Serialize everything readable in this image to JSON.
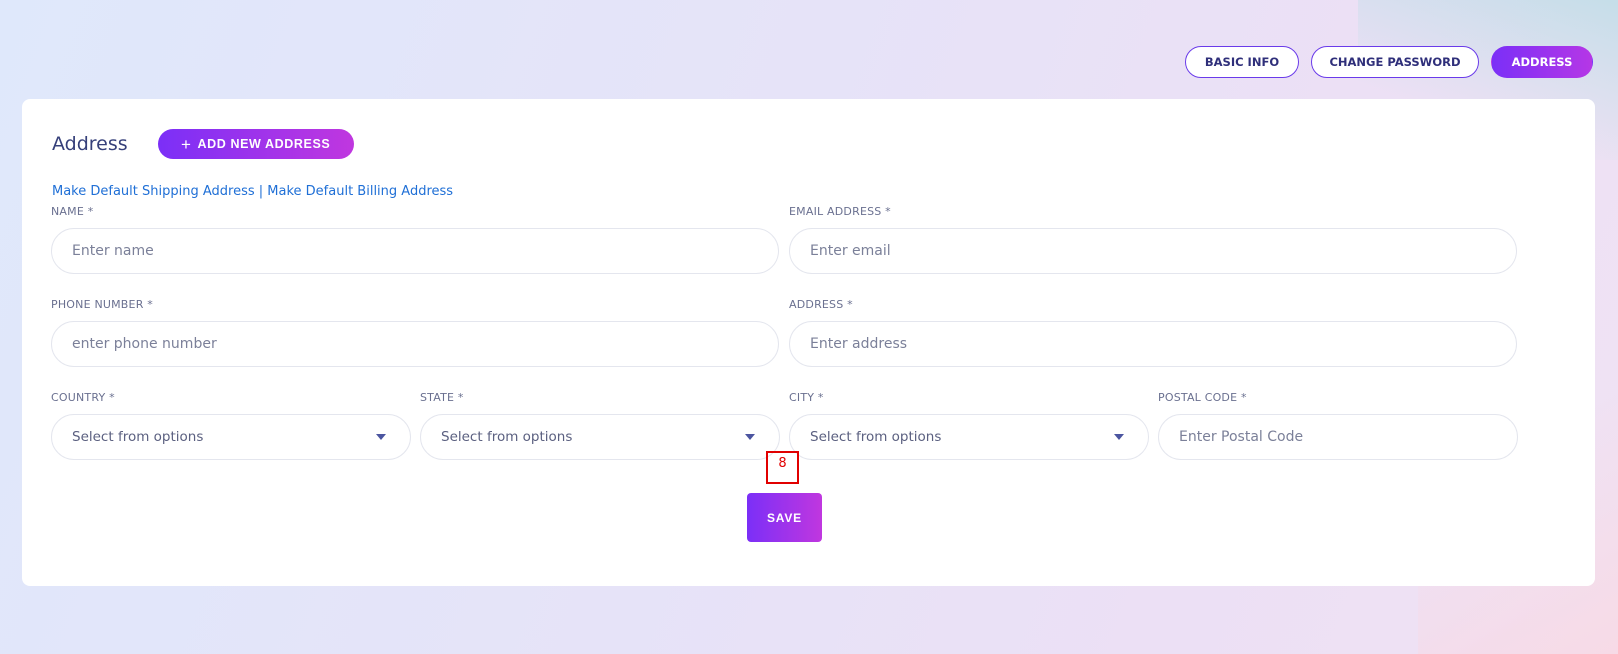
{
  "tabs": {
    "basic_info": "BASIC INFO",
    "change_password": "CHANGE PASSWORD",
    "address": "ADDRESS"
  },
  "card": {
    "title": "Address",
    "add_button": "ADD NEW ADDRESS",
    "link_shipping": "Make Default Shipping Address",
    "link_separator": "|",
    "link_billing": "Make Default Billing Address"
  },
  "form": {
    "name": {
      "label": "NAME *",
      "placeholder": "Enter name"
    },
    "email": {
      "label": "EMAIL ADDRESS *",
      "placeholder": "Enter email"
    },
    "phone": {
      "label": "PHONE NUMBER *",
      "placeholder": "enter phone number"
    },
    "address": {
      "label": "ADDRESS *",
      "placeholder": "Enter address"
    },
    "country": {
      "label": "COUNTRY *",
      "value": "Select from options"
    },
    "state": {
      "label": "STATE *",
      "value": "Select from options"
    },
    "city": {
      "label": "CITY *",
      "value": "Select from options"
    },
    "postal": {
      "label": "POSTAL CODE *",
      "placeholder": "Enter Postal Code"
    },
    "save_label": "SAVE"
  },
  "annotation": {
    "marker_label": "8"
  },
  "colors": {
    "accent_start": "#7b2ff7",
    "accent_end": "#c037df",
    "link": "#1f6fd6",
    "marker": "#e10000"
  },
  "icons": [
    "plus-icon",
    "chevron-down-icon"
  ]
}
